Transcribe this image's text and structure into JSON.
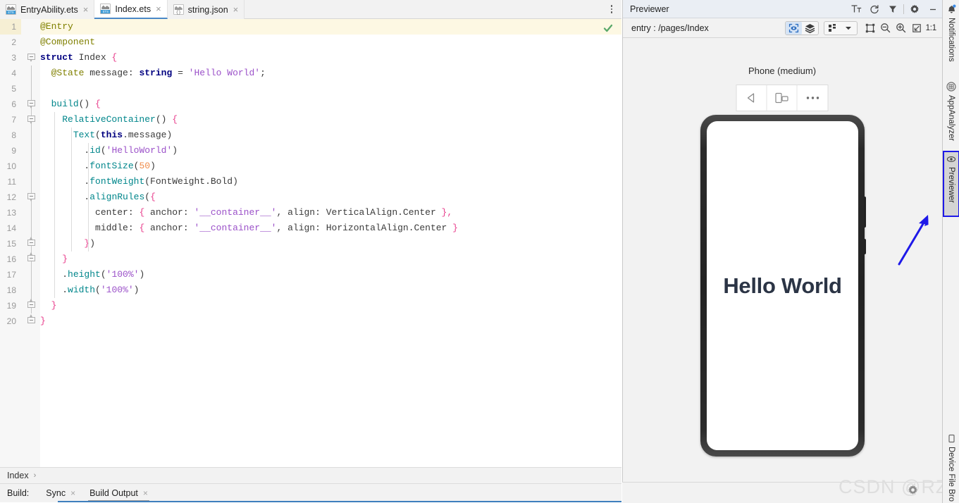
{
  "editor": {
    "tabs": [
      {
        "label": "EntryAbility.ets",
        "icon": "ets-file-icon",
        "active": false,
        "close": "×"
      },
      {
        "label": "Index.ets",
        "icon": "ets-file-icon",
        "active": true,
        "close": "×"
      },
      {
        "label": "string.json",
        "icon": "json-file-icon",
        "active": false,
        "close": "×"
      }
    ],
    "more_icon": "vertical-dots-icon",
    "inspection_status": "ok-check-icon",
    "line_numbers": [
      1,
      2,
      3,
      4,
      5,
      6,
      7,
      8,
      9,
      10,
      11,
      12,
      13,
      14,
      15,
      16,
      17,
      18,
      19,
      20
    ],
    "code_lines": [
      "@Entry",
      "@Component",
      "struct Index {",
      "  @State message: string = 'Hello World';",
      "",
      "  build() {",
      "    RelativeContainer() {",
      "      Text(this.message)",
      "        .id('HelloWorld')",
      "        .fontSize(50)",
      "        .fontWeight(FontWeight.Bold)",
      "        .alignRules({",
      "          center: { anchor: '__container__', align: VerticalAlign.Center },",
      "          middle: { anchor: '__container__', align: HorizontalAlign.Center }",
      "        })",
      "    }",
      "    .height('100%')",
      "    .width('100%')",
      "  }",
      "}"
    ],
    "breadcrumb": {
      "item": "Index",
      "separator": "›"
    }
  },
  "build_bar": {
    "label": "Build:",
    "tabs": [
      {
        "label": "Sync",
        "close": "×",
        "active": false
      },
      {
        "label": "Build Output",
        "close": "×",
        "active": true
      }
    ]
  },
  "previewer": {
    "title": "Previewer",
    "title_icons": [
      "text-size-icon",
      "refresh-icon",
      "filter-icon",
      "gear-icon",
      "minimize-icon"
    ],
    "path": "entry : /pages/Index",
    "toolbar": {
      "inspect_icon": "inspector-eye-icon",
      "layers_icon": "layers-icon",
      "grid_icon": "grid-layout-icon",
      "dropdown_icon": "chevron-down-icon",
      "frame_icon": "bounds-frame-icon",
      "zoom_out_icon": "zoom-out-icon",
      "zoom_in_icon": "zoom-in-icon",
      "fit_icon": "fit-to-window-icon",
      "zoom_ratio": "1:1"
    },
    "device": {
      "name": "Phone (medium)",
      "controls": [
        "rotate-left-icon",
        "orientation-toggle-icon",
        "more-options-icon"
      ],
      "screen_text": "Hello World"
    }
  },
  "tool_strip": [
    {
      "label": "Notifications",
      "icon": "bell-icon",
      "selected": false
    },
    {
      "label": "AppAnalyzer",
      "icon": "analyzer-icon",
      "selected": false
    },
    {
      "label": "Previewer",
      "icon": "eye-icon",
      "selected": true
    },
    {
      "label": "Device File Bro",
      "icon": "device-file-icon",
      "selected": false
    }
  ],
  "annotations": {
    "arrow": "blue-arrow-pointing-to-previewer",
    "watermark": "CSDN @RZe"
  },
  "colors": {
    "accent_blue": "#4a88c7",
    "annotation_blue": "#1e19e8",
    "decorator": "#808000",
    "keyword": "#000080",
    "function": "#00868b",
    "string": "#9b51c9",
    "number": "#f08c4b",
    "brace": "#e83e8c",
    "highlight_line": "#fdf8e3"
  }
}
